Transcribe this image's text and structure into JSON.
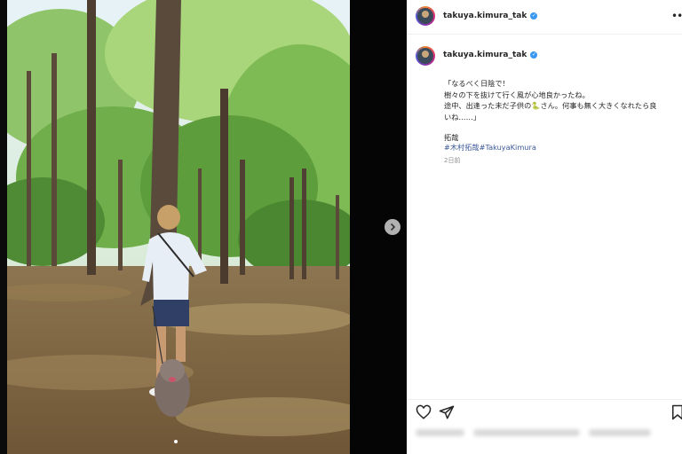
{
  "post": {
    "username": "takuya.kimura_tak",
    "verified": true,
    "caption_lines": [
      "「なるべく日陰で！",
      "樹々の下を抜けて行く風が心地良かったね。",
      "途中、出逢った未だ子供の🐍さん。何事も無く大きくなれたら良",
      "いね……」"
    ],
    "signature": "拓哉",
    "hashtags": "#木村拓哉#TakuyaKimura",
    "time": "2日前"
  },
  "icons": {
    "next": "chevron-right-icon",
    "more": "more-options-icon",
    "like": "heart-icon",
    "share": "paper-plane-icon",
    "save": "bookmark-icon",
    "verified": "verified-badge-icon"
  },
  "colors": {
    "link": "#3b5998",
    "verified": "#3897f0",
    "text": "#262626",
    "muted": "#8e8e8e"
  }
}
